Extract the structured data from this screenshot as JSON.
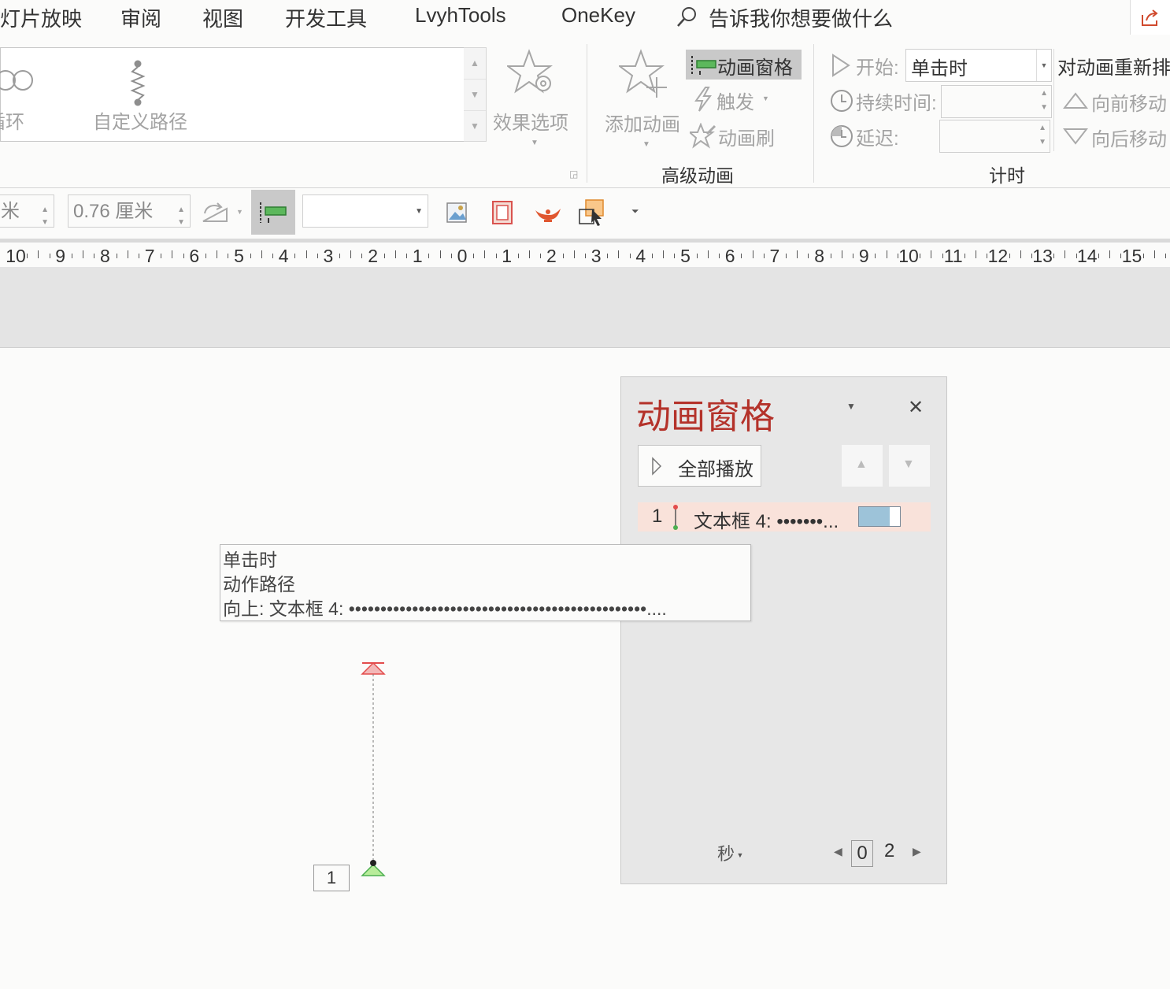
{
  "menu": {
    "tabs": [
      "灯片放映",
      "审阅",
      "视图",
      "开发工具",
      "LvyhTools",
      "OneKey"
    ],
    "tell_me": "告诉我你想要做什么"
  },
  "ribbon": {
    "gallery": {
      "item_loop": "循环",
      "item_custom_path": "自定义路径"
    },
    "effect_options": "效果选项",
    "advanced": {
      "add_animation": "添加动画",
      "animation_pane": "动画窗格",
      "trigger": "触发",
      "animation_painter": "动画刷",
      "group_label": "高级动画"
    },
    "timing": {
      "start_label": "开始:",
      "start_value": "单击时",
      "duration_label": "持续时间:",
      "delay_label": "延迟:",
      "reorder_label": "对动画重新排",
      "move_earlier": "向前移动",
      "move_later": "向后移动",
      "group_label": "计时"
    }
  },
  "format_bar": {
    "width_value": "米",
    "height_value": "0.76 厘米"
  },
  "ruler": {
    "labels": [
      "10",
      "9",
      "8",
      "7",
      "6",
      "5",
      "4",
      "3",
      "2",
      "1",
      "0",
      "1",
      "2",
      "3",
      "4",
      "5",
      "6",
      "7",
      "8",
      "9",
      "10",
      "11",
      "12",
      "13",
      "14",
      "15"
    ]
  },
  "anim_pane": {
    "title": "动画窗格",
    "play_all": "全部播放",
    "items": [
      {
        "index": "1",
        "label": "文本框 4: •••••••..."
      }
    ],
    "time_unit": "秒",
    "time_scale_start": "0",
    "time_scale_end": "2"
  },
  "tooltip": {
    "line1": "单击时",
    "line2": "动作路径",
    "line3": "向上: 文本框 4: •••••••••••••••••••••••••••••••••••••••••••••••...."
  },
  "slide": {
    "anim_tag": "1"
  },
  "colors": {
    "pane_title": "#b4322a",
    "row_highlight": "#f9e2da",
    "timeline_bar": "#9dc3d9",
    "path_start": "#7ed957",
    "path_end": "#e34c4c"
  }
}
